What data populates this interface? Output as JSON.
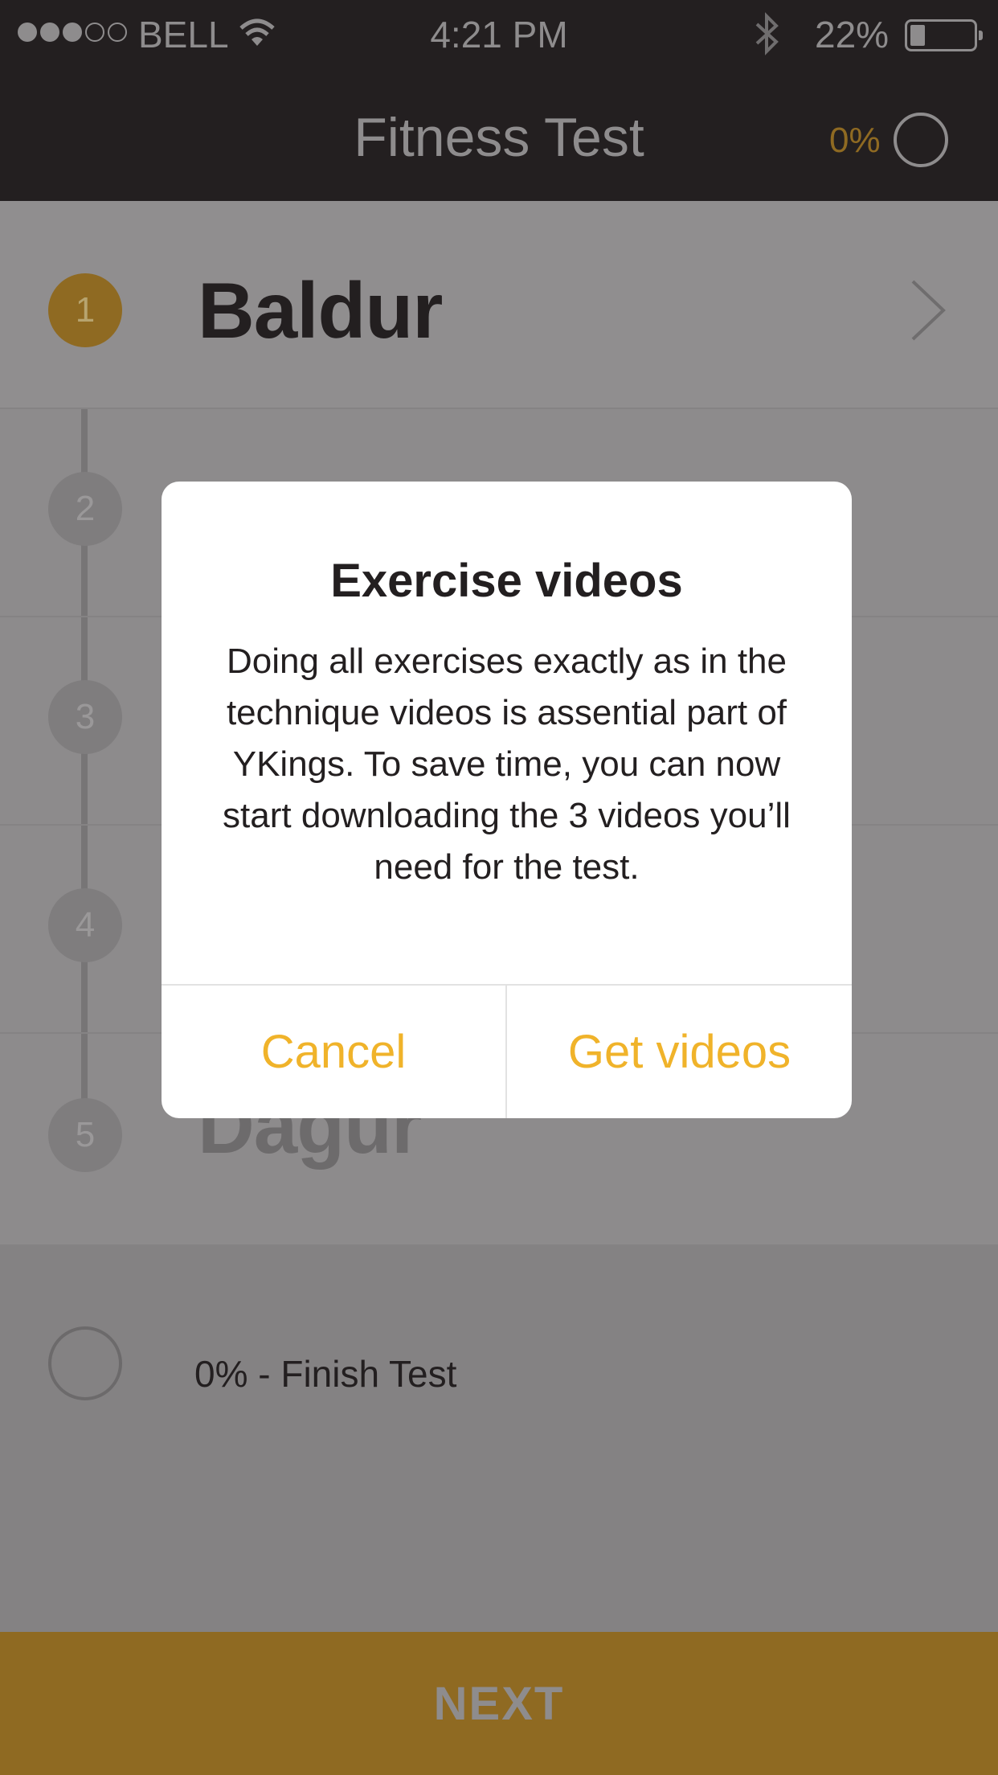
{
  "status_bar": {
    "carrier": "BELL",
    "time": "4:21 PM",
    "battery": "22%",
    "battery_fraction": 0.22,
    "signal_bars_filled": 3,
    "signal_bars_total": 5
  },
  "header": {
    "title": "Fitness Test",
    "progress": "0%"
  },
  "steps": [
    {
      "number": "1",
      "name": "Baldur",
      "active": true
    },
    {
      "number": "2",
      "name": "",
      "active": false
    },
    {
      "number": "3",
      "name": "",
      "active": false
    },
    {
      "number": "4",
      "name": "",
      "active": false
    },
    {
      "number": "5",
      "name": "Dagur",
      "active": false
    }
  ],
  "finish": {
    "label": "0% - Finish Test"
  },
  "footer": {
    "next_label": "NEXT"
  },
  "dialog": {
    "title": "Exercise videos",
    "body": "Doing all exercises exactly as in the technique videos is assential part of YKings. To save time, you can now start downloading the 3 videos you’ll need for the test.",
    "cancel_label": "Cancel",
    "confirm_label": "Get videos"
  },
  "colors": {
    "accent": "#f0b32a",
    "header_bg": "#231f20",
    "overlay_accent": "#8f6a22"
  }
}
